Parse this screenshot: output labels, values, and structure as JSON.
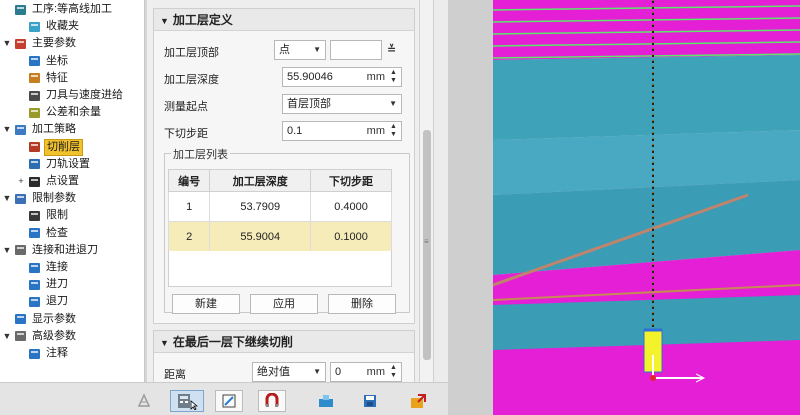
{
  "tree": {
    "items": [
      {
        "label": "工序:等高线加工",
        "depth": 0,
        "toggle": "",
        "icon": "operation-icon"
      },
      {
        "label": "收藏夹",
        "depth": 1,
        "toggle": "",
        "icon": "favorites-star-icon"
      },
      {
        "label": "主要参数",
        "depth": 0,
        "toggle": "▼",
        "icon": "main-params-icon"
      },
      {
        "label": "坐标",
        "depth": 1,
        "toggle": "",
        "icon": "coordinate-icon"
      },
      {
        "label": "特征",
        "depth": 1,
        "toggle": "",
        "icon": "feature-icon"
      },
      {
        "label": "刀具与速度进给",
        "depth": 1,
        "toggle": "",
        "icon": "tool-speed-icon"
      },
      {
        "label": "公差和余量",
        "depth": 1,
        "toggle": "",
        "icon": "tolerance-icon"
      },
      {
        "label": "加工策略",
        "depth": 0,
        "toggle": "▼",
        "icon": "strategy-icon"
      },
      {
        "label": "切削层",
        "depth": 1,
        "toggle": "",
        "icon": "cut-layer-icon",
        "selected": true
      },
      {
        "label": "刀轨设置",
        "depth": 1,
        "toggle": "",
        "icon": "toolpath-settings-icon"
      },
      {
        "label": "点设置",
        "depth": 1,
        "toggle": "+",
        "icon": "point-settings-icon"
      },
      {
        "label": "限制参数",
        "depth": 0,
        "toggle": "▼",
        "icon": "limit-params-icon"
      },
      {
        "label": "限制",
        "depth": 1,
        "toggle": "",
        "icon": "limit-icon"
      },
      {
        "label": "检查",
        "depth": 1,
        "toggle": "",
        "icon": "check-icon"
      },
      {
        "label": "连接和进退刀",
        "depth": 0,
        "toggle": "▼",
        "icon": "connect-icon"
      },
      {
        "label": "连接",
        "depth": 1,
        "toggle": "",
        "icon": "link-icon"
      },
      {
        "label": "进刀",
        "depth": 1,
        "toggle": "",
        "icon": "lead-in-icon"
      },
      {
        "label": "退刀",
        "depth": 1,
        "toggle": "",
        "icon": "lead-out-icon"
      },
      {
        "label": "显示参数",
        "depth": 0,
        "toggle": "",
        "icon": "display-params-icon"
      },
      {
        "label": "高级参数",
        "depth": 0,
        "toggle": "▼",
        "icon": "advanced-params-icon"
      },
      {
        "label": "注释",
        "depth": 1,
        "toggle": "",
        "icon": "annotation-icon"
      }
    ]
  },
  "section1": {
    "title": "加工层定义",
    "rows": {
      "top_label": "加工层顶部",
      "top_value": "点",
      "depth_label": "加工层深度",
      "depth_value": "55.90046",
      "depth_unit": "mm",
      "measure_label": "测量起点",
      "measure_value": "首层顶部",
      "step_label": "下切步距",
      "step_value": "0.1",
      "step_unit": "mm"
    },
    "list": {
      "title": "加工层列表",
      "headers": [
        "编号",
        "加工层深度",
        "下切步距"
      ],
      "rows": [
        [
          "1",
          "53.7909",
          "0.4000"
        ],
        [
          "2",
          "55.9004",
          "0.1000"
        ]
      ],
      "highlight_row": 1
    },
    "buttons": {
      "new": "新建",
      "apply": "应用",
      "delete": "删除"
    }
  },
  "section2": {
    "title": "在最后一层下继续切削",
    "distance_label": "距离",
    "distance_mode": "绝对值",
    "distance_value": "0",
    "distance_unit": "mm"
  },
  "toolbar": {
    "buttons": [
      "generate-toolpath-icon",
      "calculator-icon",
      "edit-icon",
      "magnet-icon",
      "simulate-icon",
      "save-icon",
      "export-icon"
    ]
  },
  "colors": {
    "accent": "#f2c12e",
    "magenta": "#e41fd6",
    "teal": "#3ea3b8",
    "toolpath_green": "#5de86a"
  }
}
